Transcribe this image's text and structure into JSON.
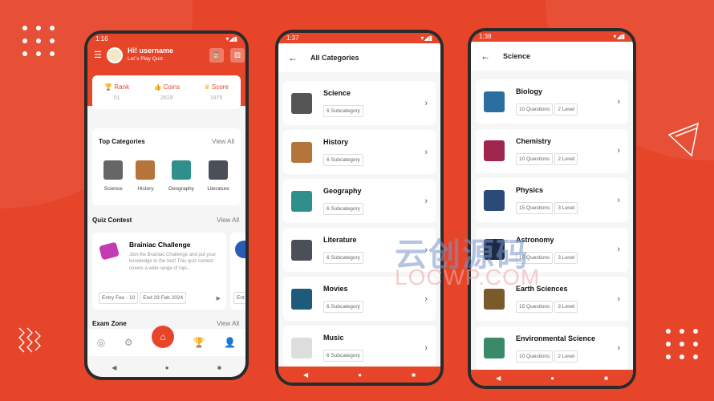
{
  "colors": {
    "brand": "#e6452a",
    "background": "#e6452a"
  },
  "home": {
    "time": "1:16",
    "greeting": "Hi! username",
    "subtitle": "Let`s Play Quiz",
    "stats": [
      {
        "label": "Rank",
        "value": "01",
        "icon": "trophy-icon"
      },
      {
        "label": "Coins",
        "value": "2619",
        "icon": "coins-icon"
      },
      {
        "label": "Score",
        "value": "1975",
        "icon": "crown-icon"
      }
    ],
    "top_categories": {
      "title": "Top Categories",
      "view_all": "View All",
      "items": [
        "Science",
        "History",
        "Geography",
        "Literature"
      ]
    },
    "quiz_contest": {
      "title": "Quiz Contest",
      "view_all": "View All",
      "name": "Brainiac Challenge",
      "description": "Join the Brainiac Challenge and put your knowledge to the test! This quiz contest covers a wide range of topi...",
      "entry_fee": "Entry Fee - 10",
      "end": "End  29 Feb 2024",
      "next_peek": "Ent"
    },
    "exam_zone": {
      "title": "Exam Zone",
      "view_all": "View All"
    },
    "bottom_nav": [
      "compass-icon",
      "settings-icon",
      "home-icon",
      "trophy-icon",
      "profile-icon"
    ]
  },
  "categories": {
    "time": "1:37",
    "title": "All Categories",
    "items": [
      {
        "name": "Science",
        "sub": "6 Subcategory",
        "color": "#555"
      },
      {
        "name": "History",
        "sub": "6 Subcategory",
        "color": "#b5743a"
      },
      {
        "name": "Geography",
        "sub": "6 Subcategory",
        "color": "#2f8f8a"
      },
      {
        "name": "Literature",
        "sub": "6 Subcategory",
        "color": "#4a4f58"
      },
      {
        "name": "Movies",
        "sub": "6 Subcategory",
        "color": "#1e5a7a"
      },
      {
        "name": "Music",
        "sub": "6 Subcategory",
        "color": "#ddd"
      }
    ]
  },
  "science": {
    "time": "1:38",
    "title": "Science",
    "items": [
      {
        "name": "Biology",
        "questions": "10 Questions",
        "level": "2 Level",
        "color": "#2a6fa0"
      },
      {
        "name": "Chemistry",
        "questions": "10 Questions",
        "level": "2 Level",
        "color": "#a0264e"
      },
      {
        "name": "Physics",
        "questions": "15 Questions",
        "level": "3 Level",
        "color": "#2b4a7a"
      },
      {
        "name": "Astronomy",
        "questions": "15 Questions",
        "level": "3 Level",
        "color": "#1c2a48"
      },
      {
        "name": "Earth Sciences",
        "questions": "15 Questions",
        "level": "3 Level",
        "color": "#7a5a2a"
      },
      {
        "name": "Environmental Science",
        "questions": "10 Questions",
        "level": "2 Level",
        "color": "#3a8a6a"
      }
    ]
  },
  "watermark": {
    "cn": "云创源码",
    "en": "LOCWP.COM"
  }
}
